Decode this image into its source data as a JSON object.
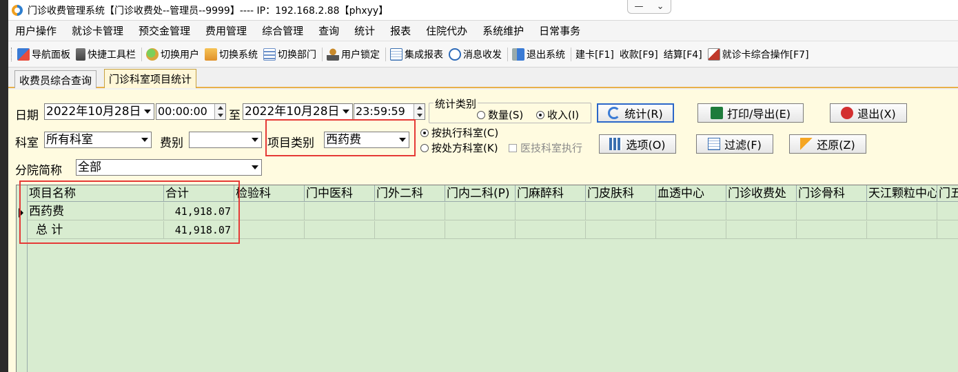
{
  "window": {
    "title": "门诊收费管理系统【门诊收费处--管理员--9999】---- IP：192.168.2.88【phxyy】",
    "min_glyph": "—",
    "restore_glyph": "⌄"
  },
  "menu": [
    "用户操作",
    "就诊卡管理",
    "预交金管理",
    "费用管理",
    "综合管理",
    "查询",
    "统计",
    "报表",
    "住院代办",
    "系统维护",
    "日常事务"
  ],
  "toolbar": [
    {
      "label": "导航面板",
      "icon": "navigation-panel-icon",
      "color": "#3a7bd5"
    },
    {
      "label": "快捷工具栏",
      "icon": "shortcut-toolbar-icon",
      "color": "#5a5a5a"
    },
    {
      "label": "切换用户",
      "icon": "switch-user-icon",
      "color": "#4caf50"
    },
    {
      "label": "切换系统",
      "icon": "switch-system-icon",
      "color": "#e09a2a"
    },
    {
      "label": "切换部门",
      "icon": "switch-department-icon",
      "color": "#6a8fc8"
    },
    {
      "label": "用户锁定",
      "icon": "user-lock-icon",
      "color": "#c98a2a"
    },
    {
      "label": "集成报表",
      "icon": "integrated-report-icon",
      "color": "#3a6fb0"
    },
    {
      "label": "消息收发",
      "icon": "message-icon",
      "color": "#2d6ab8"
    },
    {
      "label": "退出系统",
      "icon": "exit-system-icon",
      "color": "#3a7bd5"
    },
    {
      "label": "建卡[F1]",
      "icon": "",
      "color": ""
    },
    {
      "label": "收款[F9]",
      "icon": "",
      "color": ""
    },
    {
      "label": "结算[F4]",
      "icon": "",
      "color": ""
    },
    {
      "label": "就诊卡综合操作[F7]",
      "icon": "card-operation-icon",
      "color": "#c0392b"
    }
  ],
  "tabs": [
    {
      "label": "收费员综合查询",
      "active": false
    },
    {
      "label": "门诊科室项目统计",
      "active": true
    }
  ],
  "filters": {
    "date_label": "日期",
    "date_from": "2022年10月28日",
    "time_from": "00:00:00",
    "to_label": "至",
    "date_to": "2022年10月28日",
    "time_to": "23:59:59",
    "dept_label": "科室",
    "dept_value": "所有科室",
    "fee_label": "费别",
    "fee_value": "",
    "item_cat_label": "项目类别",
    "item_cat_value": "西药费",
    "branch_label": "分院简称",
    "branch_value": "全部"
  },
  "stat_type": {
    "title": "统计类别",
    "quantity_label": "数量(S)",
    "income_label": "收入(I)",
    "selected": "income"
  },
  "dept_mode": {
    "exec_label": "按执行科室(C)",
    "presc_label": "按处方科室(K)",
    "tech_exec_label": "医技科室执行",
    "selected": "exec"
  },
  "buttons": {
    "stat": "统计(R)",
    "print": "打印/导出(E)",
    "exit": "退出(X)",
    "options": "选项(O)",
    "filter": "过滤(F)",
    "restore": "还原(Z)"
  },
  "grid": {
    "columns": [
      "项目名称",
      "合计",
      "检验科",
      "门中医科",
      "门外二科",
      "门内二科(P)",
      "门麻醉科",
      "门皮肤科",
      "血透中心",
      "门诊收费处",
      "门诊骨科",
      "天江颗粒中心",
      "门五"
    ],
    "rows": [
      {
        "name": "西药费",
        "total": "41,918.07",
        "current": true
      },
      {
        "name": "总 计",
        "total": "41,918.07",
        "current": false
      }
    ]
  }
}
